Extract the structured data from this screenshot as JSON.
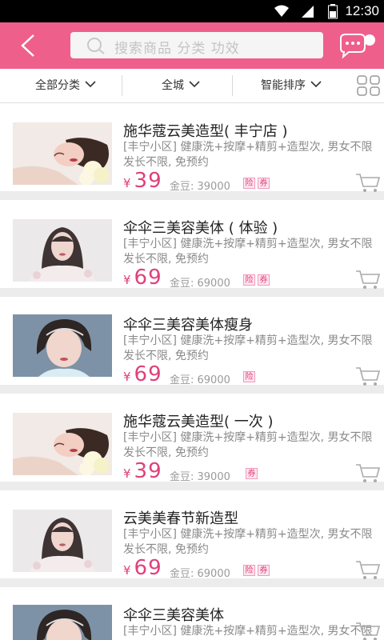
{
  "status_bar": {
    "time": "12:30"
  },
  "search": {
    "placeholder": "搜索商品 分类 功效"
  },
  "filters": {
    "category": "全部分类",
    "region": "全城",
    "sort": "智能排序"
  },
  "items": [
    {
      "title": "施华蔻云美造型( 丰宁店 )",
      "desc": "[丰宁小区] 健康洗+按摩+精剪+造型次, 男女不限发长不限, 免预约",
      "currency": "¥",
      "price": "39",
      "beans": "金豆: 39000",
      "tag1": "险",
      "tag2": "券",
      "image": "woman-with-flowers"
    },
    {
      "title": "伞伞三美容美体 ( 体验 )",
      "desc": "[丰宁小区] 健康洗+按摩+精剪+造型次, 男女不限发长不限, 免预约",
      "currency": "¥",
      "price": "69",
      "beans": "金豆: 69000",
      "tag1": "险",
      "tag2": "券",
      "image": "woman-long-hair"
    },
    {
      "title": "伞伞三美容美体瘦身",
      "desc": "[丰宁小区] 健康洗+按摩+精剪+造型次, 男女不限发长不限, 免预约",
      "currency": "¥",
      "price": "69",
      "beans": "金豆: 69000",
      "tag1": "险",
      "image": "woman-braid"
    },
    {
      "title": "施华蔻云美造型( 一次 )",
      "desc": "[丰宁小区] 健康洗+按摩+精剪+造型次, 男女不限发长不限, 免预约",
      "currency": "¥",
      "price": "39",
      "beans": "金豆: 39000",
      "tag1": "券",
      "image": "woman-with-flowers"
    },
    {
      "title": "云美美春节新造型",
      "desc": "[丰宁小区] 健康洗+按摩+精剪+造型次, 男女不限发长不限, 免预约",
      "currency": "¥",
      "price": "69",
      "beans": "金豆: 69000",
      "tag1": "险",
      "tag2": "券",
      "image": "woman-long-hair"
    },
    {
      "title": "伞伞三美容美体",
      "desc": "[丰宁小区] 健康洗+按摩+精剪+造型次, 男女不限发长不限, 免预约",
      "image": "woman-braid"
    }
  ],
  "colors": {
    "accent": "#ef5f8c",
    "price": "#e0407a"
  }
}
